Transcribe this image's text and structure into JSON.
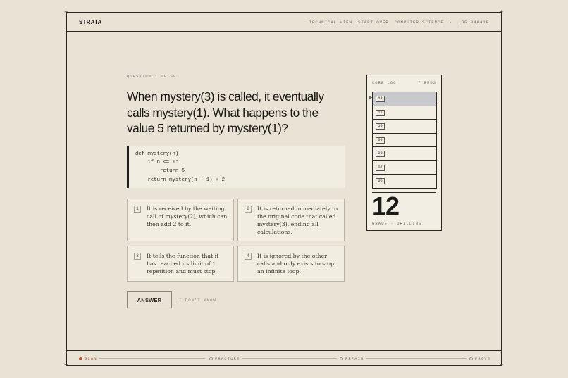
{
  "app": {
    "brand": "STRATA"
  },
  "topnav": [
    "TECHNICAL VIEW",
    "START OVER",
    "COMPUTER SCIENCE",
    "·",
    "LOG 84A41B"
  ],
  "question": {
    "counter": "QUESTION 1 OF ~8",
    "text": "When mystery(3) is called, it eventually calls mystery(1). What happens to the value 5 returned by mystery(1)?",
    "code": "def mystery(n):\n    if n <= 1:\n        return 5\n    return mystery(n - 1) + 2"
  },
  "options": [
    {
      "num": "1",
      "text": "It is received by the waiting call of mystery(2), which can then add 2 to it."
    },
    {
      "num": "2",
      "text": "It is returned immediately to the original code that called mystery(3), ending all calculations."
    },
    {
      "num": "3",
      "text": "It tells the function that it has reached its limit of 1 repetition and must stop."
    },
    {
      "num": "4",
      "text": "It is ignored by the other calls and only exists to stop an infinite loop."
    }
  ],
  "actions": {
    "answer": "ANSWER",
    "dont_know": "I DON'T KNOW"
  },
  "core_log": {
    "title": "CORE LOG",
    "count": "7 BEDS",
    "beds": [
      "12",
      "11",
      "10",
      "09",
      "08",
      "07",
      "06"
    ],
    "active_bed": "12",
    "grade_value": "12",
    "grade_label": "GRADE · DRILLING"
  },
  "progress": {
    "steps": [
      "SCAN",
      "FRACTURE",
      "REPAIR",
      "PROVE"
    ],
    "active_step": "SCAN"
  },
  "colors": {
    "background": "#e9e3d6",
    "accent": "#b5543c",
    "active_bed": "#c7c9cd"
  }
}
